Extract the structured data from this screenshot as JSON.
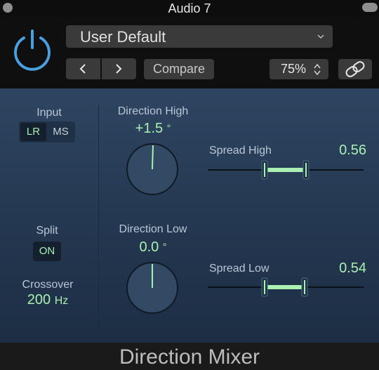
{
  "window": {
    "title": "Audio 7"
  },
  "header": {
    "preset": "User Default",
    "compare_label": "Compare",
    "zoom": "75%"
  },
  "input": {
    "label": "Input",
    "options": [
      "LR",
      "MS"
    ],
    "selected": "LR"
  },
  "split": {
    "label": "Split",
    "state": "ON"
  },
  "crossover": {
    "label": "Crossover",
    "value": "200",
    "unit": "Hz"
  },
  "direction_high": {
    "label": "Direction High",
    "value": "+1.5",
    "unit": "°"
  },
  "direction_low": {
    "label": "Direction Low",
    "value": "0.0",
    "unit": "°"
  },
  "spread_high": {
    "label": "Spread High",
    "value": "0.56"
  },
  "spread_low": {
    "label": "Spread Low",
    "value": "0.54"
  },
  "footer": {
    "plugin_name": "Direction Mixer"
  },
  "colors": {
    "accent_value": "#a9f0b2",
    "power": "#4a9fe0",
    "panel_top": "#2e4561",
    "panel_bottom": "#1d2e44"
  },
  "icons": [
    "power-icon",
    "chevron-down-icon",
    "arrow-left-icon",
    "arrow-right-icon",
    "up-down-stepper-icon",
    "link-icon"
  ]
}
